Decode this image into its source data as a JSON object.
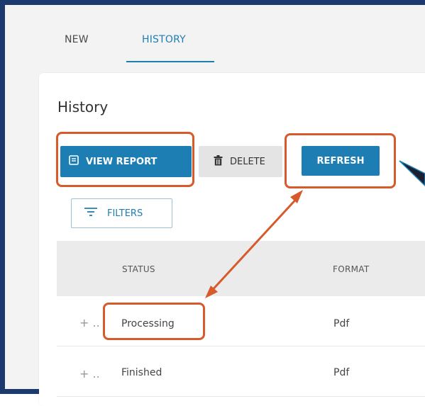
{
  "tabs": [
    {
      "label": "NEW"
    },
    {
      "label": "HISTORY"
    }
  ],
  "panel": {
    "title": "History"
  },
  "toolbar": {
    "view_report_label": "VIEW REPORT",
    "delete_label": "DELETE",
    "refresh_label": "REFRESH",
    "filters_label": "FILTERS"
  },
  "table": {
    "columns": [
      "STATUS",
      "FORMAT"
    ],
    "rows": [
      {
        "status": "Processing",
        "format": "Pdf"
      },
      {
        "status": "Finished",
        "format": "Pdf"
      }
    ]
  },
  "colors": {
    "accent": "#1d7eb4",
    "annotation": "#d65a2c",
    "frame": "#1c3a6e"
  }
}
